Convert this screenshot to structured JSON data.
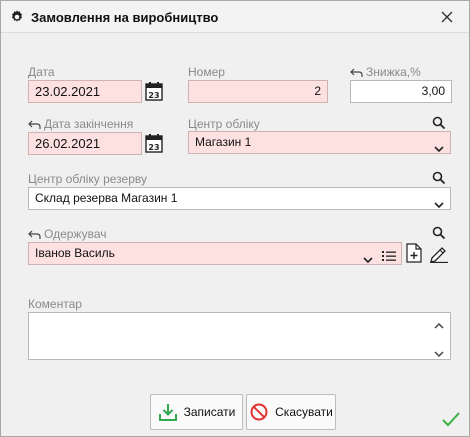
{
  "dialog": {
    "title": "Замовлення на виробництво",
    "icons": {
      "title": "gear-icon",
      "close": "close-icon"
    }
  },
  "form": {
    "date": {
      "label": "Дата",
      "value": "23.02.2021"
    },
    "number": {
      "label": "Номер",
      "value": "2"
    },
    "discount": {
      "label": "Знижка,%",
      "value": "3,00"
    },
    "end_date": {
      "label": "Дата закінчення",
      "value": "26.02.2021"
    },
    "account_center": {
      "label": "Центр обліку",
      "value": "Магазин 1"
    },
    "reserve_center": {
      "label": "Центр обліку резерву",
      "value": "Склад резерва Магазин 1"
    },
    "recipient": {
      "label": "Одержувач",
      "value": "Іванов Василь"
    },
    "comment": {
      "label": "Коментар",
      "value": ""
    }
  },
  "buttons": {
    "save": "Записати",
    "cancel": "Скасувати"
  },
  "colors": {
    "required_bg": "#fde0e0",
    "save_icon": "#2fa84f",
    "cancel_icon": "#e0332f",
    "confirm_check": "#3cb043"
  }
}
